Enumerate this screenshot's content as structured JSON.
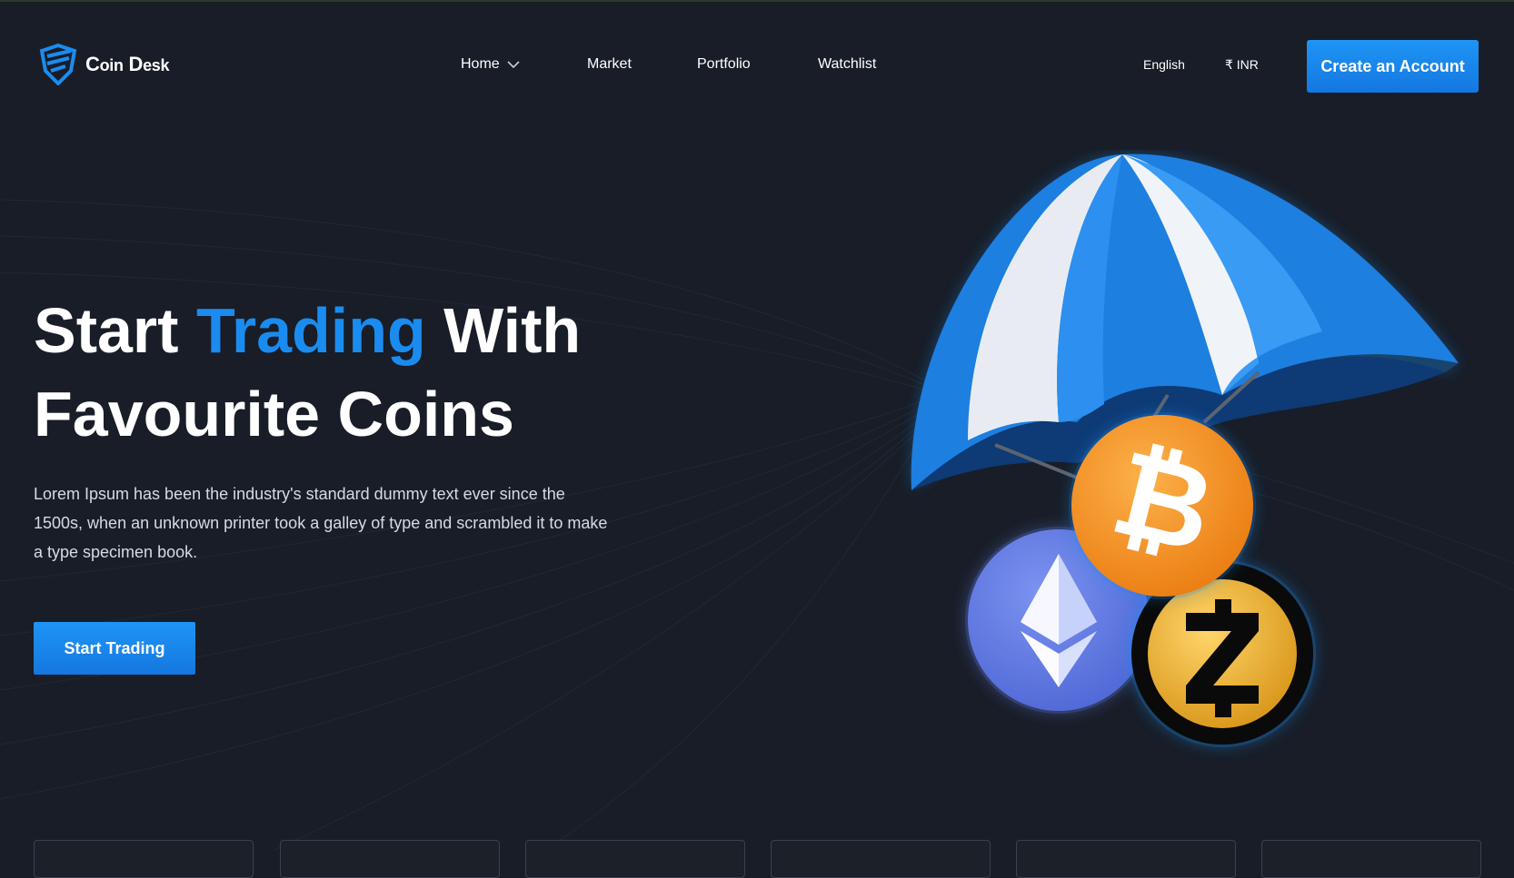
{
  "brand": {
    "name_first": "C",
    "name_first_rest": "oin",
    "name_second": "D",
    "name_second_rest": "esk",
    "logo_icon": "shield-logo-icon"
  },
  "nav": {
    "items": [
      {
        "label": "Home",
        "has_dropdown": true
      },
      {
        "label": "Market"
      },
      {
        "label": "Portfolio"
      },
      {
        "label": "Watchlist"
      }
    ]
  },
  "utility": {
    "language": "English",
    "currency": "₹ INR"
  },
  "header": {
    "cta_label": "Create an Account"
  },
  "hero": {
    "title_part1": "Start ",
    "title_accent": "Trading",
    "title_part2": " With",
    "title_line2": "Favourite Coins",
    "description": "Lorem Ipsum has been the industry's standard dummy text ever since the 1500s, when an unknown printer took a galley of type and scrambled it to make a type specimen book.",
    "button_label": "Start Trading"
  },
  "illustration": {
    "icons": [
      "parachute-icon",
      "bitcoin-icon",
      "ethereum-icon",
      "zcash-icon"
    ]
  },
  "colors": {
    "background": "#181d27",
    "accent": "#1a8cf0",
    "bitcoin": "#f7931a",
    "ethereum": "#627eea",
    "zcash": "#f4b728"
  },
  "cards": {
    "count": 6
  }
}
